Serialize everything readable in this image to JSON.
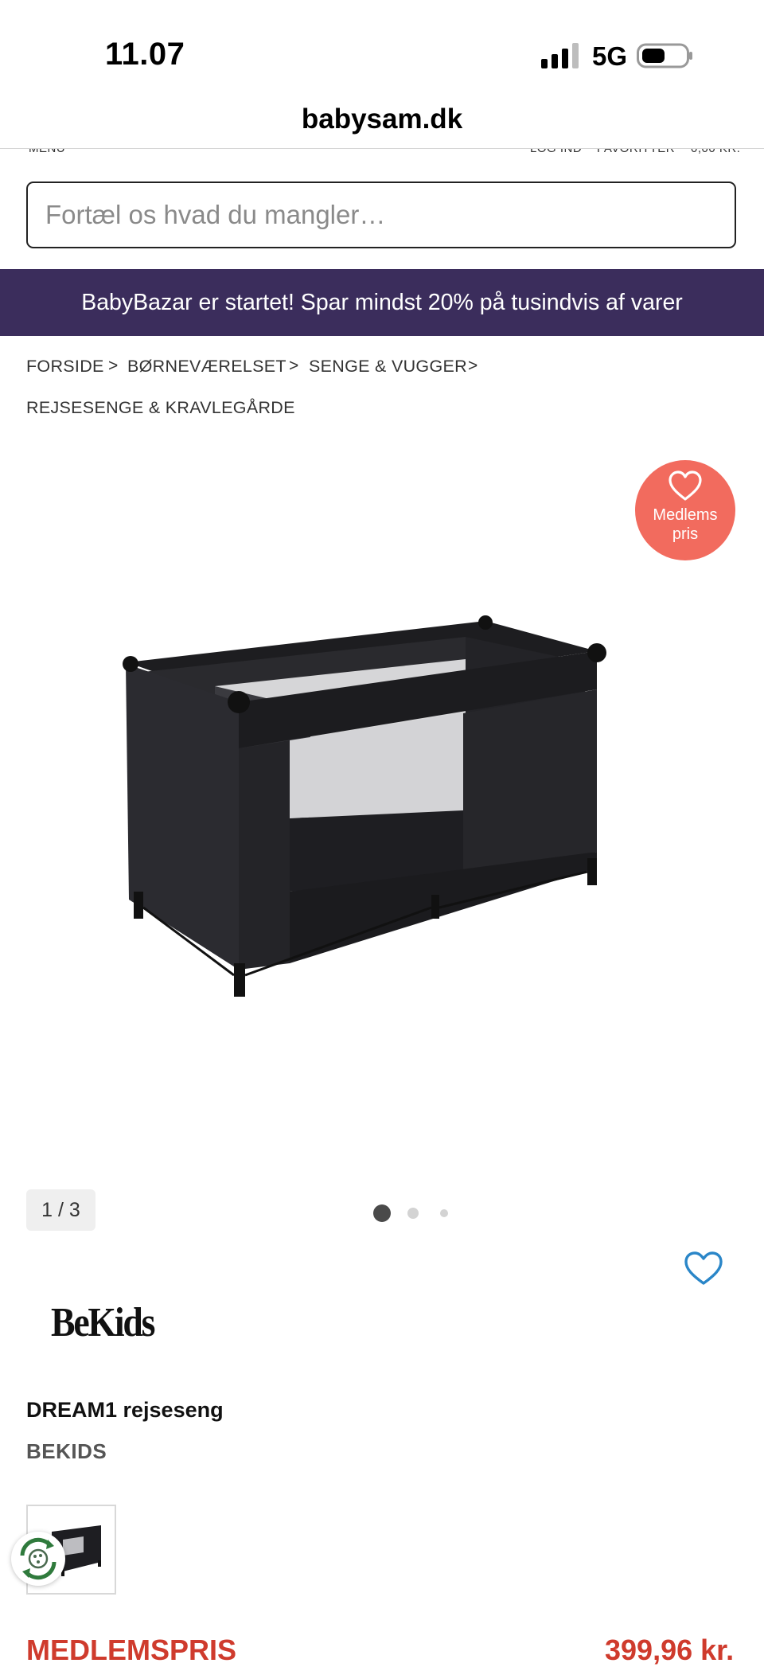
{
  "status_bar": {
    "time": "11.07",
    "network": "5G",
    "signal_icon": "signal-icon",
    "battery_icon": "battery-icon"
  },
  "browser": {
    "url": "babysam.dk"
  },
  "header": {
    "menu_label": "MENU",
    "login_label": "LOG IND",
    "favorites_label": "FAVORITTER",
    "cart_total": "0,00 KR."
  },
  "search": {
    "placeholder": "Fortæl os hvad du mangler…",
    "value": ""
  },
  "promo_banner": {
    "text": "BabyBazar er startet! Spar mindst 20% på tusindvis af varer",
    "background": "#3b2d5c"
  },
  "breadcrumb": {
    "items": [
      "FORSIDE",
      "BØRNEVÆRELSET",
      "SENGE & VUGGER",
      "REJSESENGE & KRAVLEGÅRDE"
    ],
    "separator": ">"
  },
  "gallery": {
    "counter": "1 / 3",
    "active_index": 0,
    "total": 3,
    "badge": {
      "line1": "Medlems",
      "line2": "pris",
      "color": "#f26b5e",
      "icon": "heart-icon"
    }
  },
  "product": {
    "brand_logo": "BeKids",
    "title": "DREAM1 rejseseng",
    "brand": "BEKIDS",
    "price_label": "MEDLEMSPRIS",
    "price": "399,96 kr."
  },
  "colors": {
    "accent": "#3b2d5c",
    "price": "#cf3b2d",
    "favorite": "#2a86c8"
  }
}
